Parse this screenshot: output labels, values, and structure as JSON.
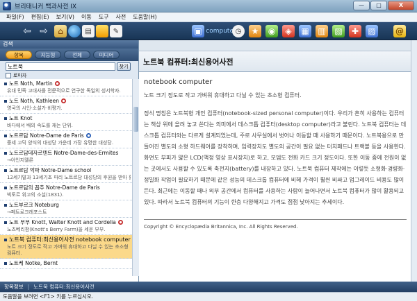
{
  "window": {
    "title": "브리태니커 백과사전 IX",
    "minimize": "—",
    "maximize": "□",
    "close": "X"
  },
  "menu": [
    "파일(F)",
    "편집(E)",
    "보기(V)",
    "이동",
    "도구",
    "사전",
    "도움말(H)"
  ],
  "toolbar": {
    "back": "⇦",
    "forward": "⇨",
    "icons": [
      "home-icon",
      "world-icon",
      "document-icon",
      "image-icon",
      "bookmark-icon",
      "notes-icon",
      "clock-icon",
      "star-icon",
      "globe-icon",
      "dictionary-icon",
      "atlas-icon",
      "media-icon",
      "quiz-icon",
      "help-icon",
      "email-icon"
    ],
    "computer_label": "computer",
    "at_symbol": "@"
  },
  "search": {
    "header": "검색",
    "tabs": [
      "항목",
      "지능형",
      "전체",
      "미디어"
    ],
    "query": "노트북",
    "button": "찾기",
    "option": "로마자"
  },
  "results": [
    {
      "title": "노트 Noth, Martin",
      "desc": "유대 민족 고대사를 전문적으로 연구한 독일의 성서학자.",
      "badge": "red"
    },
    {
      "title": "노트 Noth, Kathleen",
      "desc": "영국의 시인·소설가·비평가.",
      "badge": "red"
    },
    {
      "title": "노트 Knot",
      "desc": "바다에서 배의 속도를 재는 단위."
    },
    {
      "title": "노트르담 Notre-Dame de Paris",
      "desc": "중세 고딕 양식의 대성당 가운데 가장 유명한 대성당.",
      "badge": "blue"
    },
    {
      "title": "노트르담데자르덴트 Notre-Dame-des-Ermites",
      "desc": "→아인지델른",
      "arrow": true
    },
    {
      "title": "노트르담 악파 Notre-Dame school",
      "desc": "12세기말과 13세기초 파리 노트르담 대성당의 후원을 받아 활동한 작곡가와 가수 집단."
    },
    {
      "title": "노트르담의 꼽추 Notre-Dame de Paris",
      "desc": "빅토르 위고의 소설(1831)."
    },
    {
      "title": "노트부르크 Noteburg",
      "desc": "→페트로크레포스트",
      "arrow": true
    },
    {
      "title": "노트 부부 Knott, Walter Knott and Cordelia",
      "desc": "노츠베리팜(Knott's Berry Farm)을 세운 부부.",
      "badge": "red"
    },
    {
      "title": "노트북 컴퓨터:최신용어사전 notebook computer",
      "desc": "노트 크기 정도로 작고 가벼워 휴대하고 다닐 수 있는 초소형 컴퓨터.",
      "selected": true
    },
    {
      "title": "노트케 Notke, Bernt",
      "desc": ""
    }
  ],
  "article": {
    "title": "노트북 컴퓨터:최신용어사전",
    "english": "notebook computer",
    "lead": "노트 크기 정도로 작고 가벼워 휴대하고 다닐 수 있는 초소형 컴퓨터.",
    "body": "정식 명칭은 노트북형 개인 컴퓨터(notebook-sized personal computer)이다. 우리가 흔히 사용하는 컴퓨터는 책상 위에 올려 놓고 쓴다는 의미에서 데스크톱 컴퓨터(desktop computer)라고 불린다. 노트북 컴퓨터는 데스크톱 컴퓨터와는 다르게 설계되었는데, 주로 사무실에서 벗어나 이동할 때 사용하기 때문이다. 노트북용으로 만들어진 별도의 소형 하드웨어를 장착하며, 입력장치도 별도의 공간이 필요 없는 터치패드나 트랙볼 등을 사용한다. 화면도 부피가 얇은 LCD(액정 영상 표시장치)로 하고, 모뎀도 전화 카드 크기 정도이다. 또한 이동 중에 전원이 없는 곳에서도 사용할 수 있도록 축전지(battery)를 내장하고 있다. 노트북 컴퓨터 제작에는 이렇듯 소형화·경량화·정밀화 작업이 필요하기 때문에 같은 성능의 데스크톱 컴퓨터에 비해 가격이 훨씬 비싸고 업그레이드 비용도 많이 든다. 최근에는 이동할 때나 외부 공간에서 컴퓨터를 사용하는 사람이 늘어나면서 노트북 컴퓨터가 많이 활용되고 있다. 따라서 노트북 컴퓨터의 기능이 한층 다양해지고 가격도 점점 낮아지는 추세이다.",
    "copyright": "Copyright © Encyclopædia Britannica, Inc. All Rights Reserved."
  },
  "bottom": {
    "tab": "항목정보",
    "crumb": "노트북 컴퓨터:최신용어사전"
  },
  "status": "도움말을 보려면 <F1> 키를 누르십시오."
}
